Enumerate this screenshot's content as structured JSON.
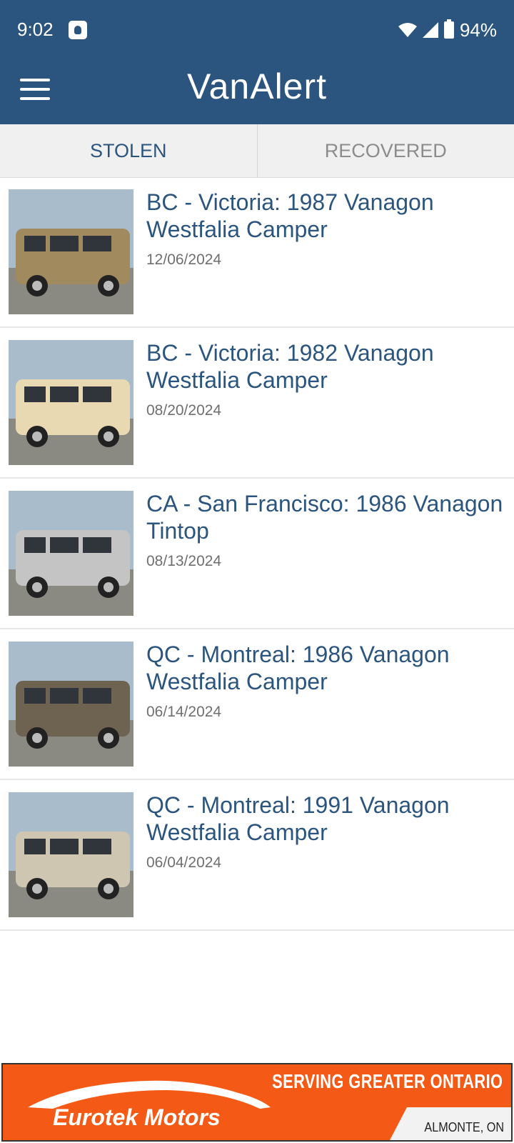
{
  "status_bar": {
    "time": "9:02",
    "battery": "94%"
  },
  "app_bar": {
    "title": "VanAlert",
    "menu_icon": "hamburger-menu-icon"
  },
  "tabs": [
    {
      "label": "STOLEN",
      "active": true
    },
    {
      "label": "RECOVERED",
      "active": false
    }
  ],
  "listings": [
    {
      "title": "BC - Victoria: 1987 Vanagon Westfalia Camper",
      "date": "12/06/2024",
      "van_color": "#a08a5e"
    },
    {
      "title": "BC - Victoria: 1982 Vanagon Westfalia Camper",
      "date": "08/20/2024",
      "van_color": "#e8d9b2"
    },
    {
      "title": "CA - San Francisco: 1986 Vanagon Tintop",
      "date": "08/13/2024",
      "van_color": "#c4c4c4"
    },
    {
      "title": "QC - Montreal: 1986 Vanagon Westfalia Camper",
      "date": "06/14/2024",
      "van_color": "#6e6350"
    },
    {
      "title": "QC - Montreal: 1991 Vanagon Westfalia Camper",
      "date": "06/04/2024",
      "van_color": "#cfc6b2"
    }
  ],
  "ad": {
    "headline": "SERVING GREATER ONTARIO",
    "brand": "Eurotek Motors",
    "location": "ALMONTE, ON",
    "background": "#f45a16"
  },
  "colors": {
    "primary": "#2b557e",
    "tab_background": "#f0f0f0",
    "date_text": "#6f6f6f"
  }
}
